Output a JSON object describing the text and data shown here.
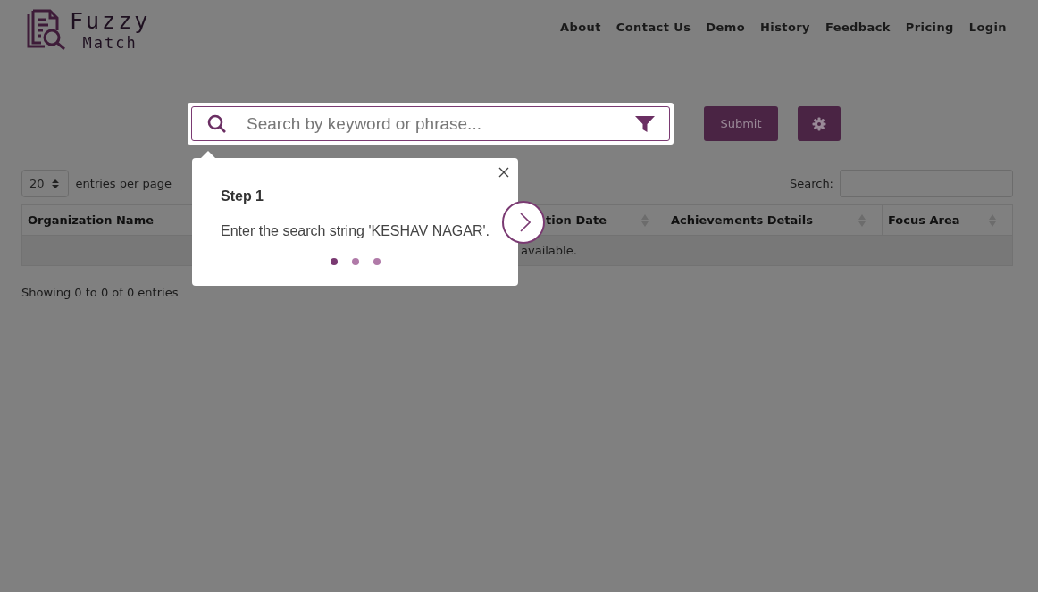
{
  "logo": {
    "title": "Fuzzy",
    "subtitle": "Match"
  },
  "nav": [
    "About",
    "Contact Us",
    "Demo",
    "History",
    "Feedback",
    "Pricing",
    "Login"
  ],
  "search": {
    "placeholder": "Search by keyword or phrase..."
  },
  "submit": "Submit",
  "entries": {
    "value": "20",
    "label": "entries per page"
  },
  "table_search": {
    "label": "Search:"
  },
  "table": {
    "columns": [
      {
        "label": "Organization Name"
      },
      {
        "label": "tion Date",
        "sortable": true
      },
      {
        "label": "Achievements Details",
        "sortable": true
      },
      {
        "label": "Focus Area",
        "sortable": true
      }
    ],
    "empty": "available."
  },
  "info": "Showing 0 to 0 of 0 entries",
  "tour": {
    "title": "Step 1",
    "text": "Enter the search string 'KESHAV NAGAR'.",
    "steps": [
      {
        "selected": true
      },
      {
        "selected": false
      },
      {
        "selected": false
      }
    ]
  }
}
